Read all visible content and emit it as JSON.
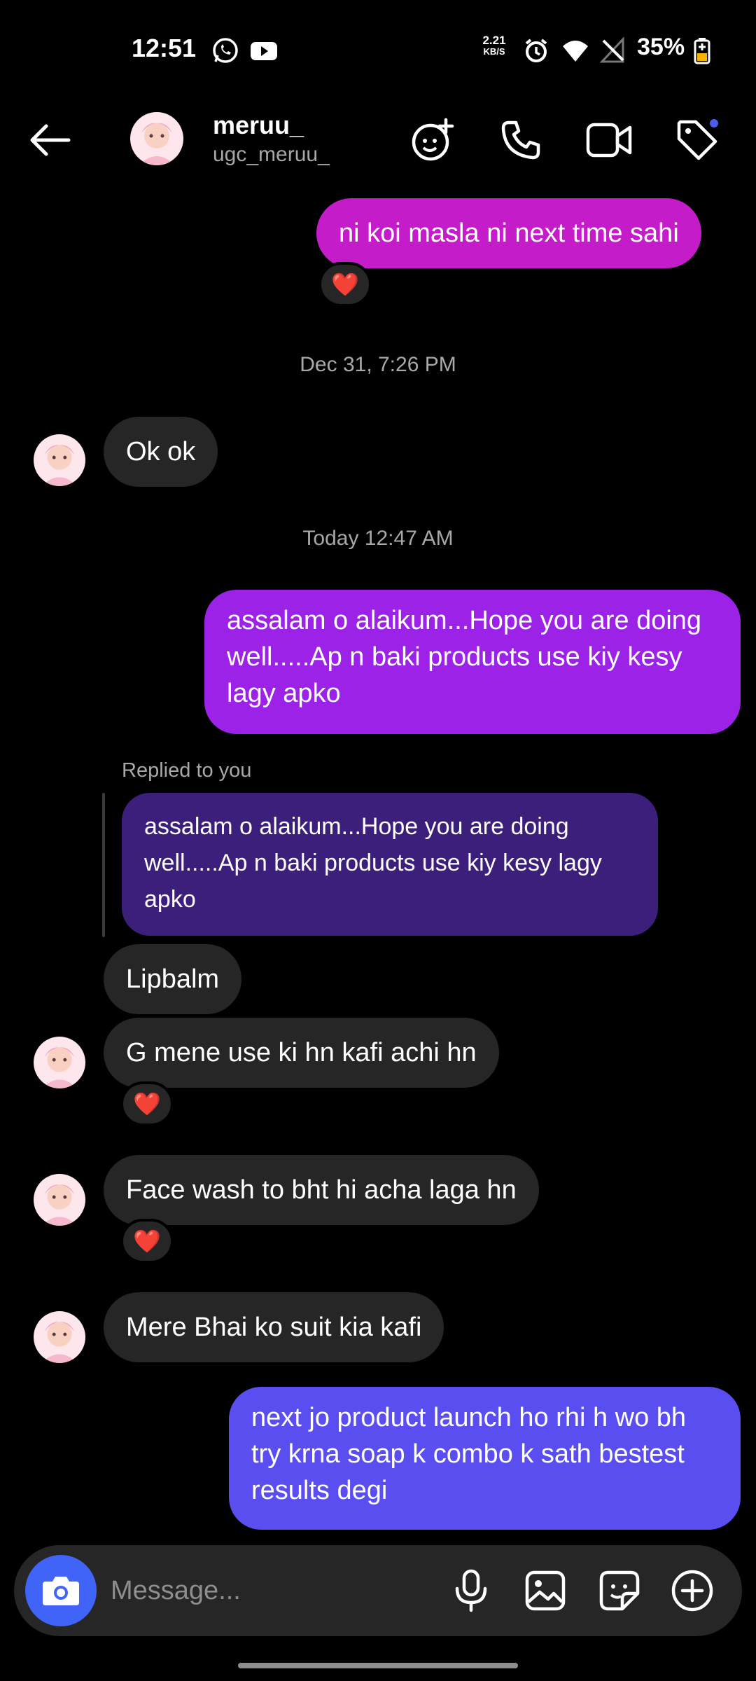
{
  "status_bar": {
    "time": "12:51",
    "net_speed_value": "2.21",
    "net_speed_unit": "KB/S",
    "battery": "35%"
  },
  "header": {
    "name": "meruu_",
    "username": "ugc_meruu_"
  },
  "messages": {
    "m1": "ni koi masla ni next time sahi",
    "ts1": "Dec 31, 7:26 PM",
    "m2": "Ok ok",
    "ts2": "Today 12:47 AM",
    "m3": "assalam o alaikum...Hope you are doing well.....Ap n baki products use kiy kesy lagy apko",
    "replied_label": "Replied to you",
    "reply_quote": "assalam o alaikum...Hope you are doing well.....Ap n baki products use kiy kesy lagy apko",
    "m4": "Lipbalm",
    "m5": "G mene use ki hn kafi achi hn",
    "m6": "Face wash to bht hi acha laga hn",
    "m7": "Mere Bhai ko suit kia kafi",
    "m8": "next jo product launch ho rhi h wo bh try krna soap k combo k sath bestest results degi"
  },
  "reaction_emoji": "❤️",
  "composer": {
    "placeholder": "Message..."
  },
  "colors": {
    "outgoing_magenta": "#c41cc8",
    "outgoing_purple": "#9b22e6",
    "outgoing_blue": "#5b4ef0",
    "incoming": "#262626",
    "reply_quote_bg": "#3c1f7a",
    "camera_button": "#3f64f7"
  }
}
